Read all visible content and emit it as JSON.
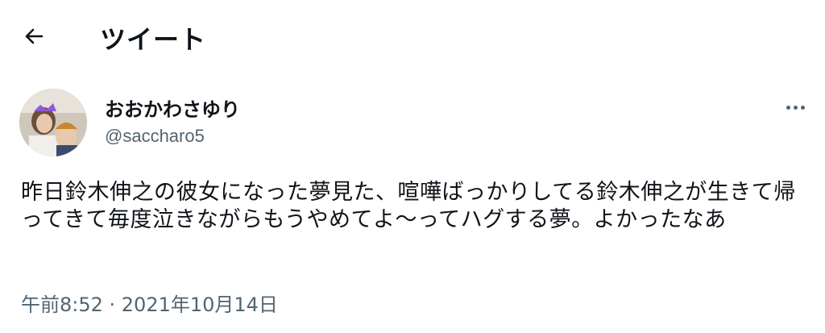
{
  "header": {
    "back_icon": "arrow-left-icon",
    "title": "ツイート"
  },
  "author": {
    "display_name": "おおかわさゆり",
    "handle": "@saccharo5"
  },
  "more_icon": "more-horizontal-icon",
  "tweet": {
    "text": "昨日鈴木伸之の彼女になった夢見た、喧嘩ばっかりしてる鈴木伸之が生きて帰ってきて毎度泣きながらもうやめてよ〜ってハグする夢。よかったなあ",
    "timestamp": "午前8:52 · 2021年10月14日"
  },
  "colors": {
    "text": "#0f1419",
    "secondary": "#536471",
    "background": "#ffffff"
  }
}
